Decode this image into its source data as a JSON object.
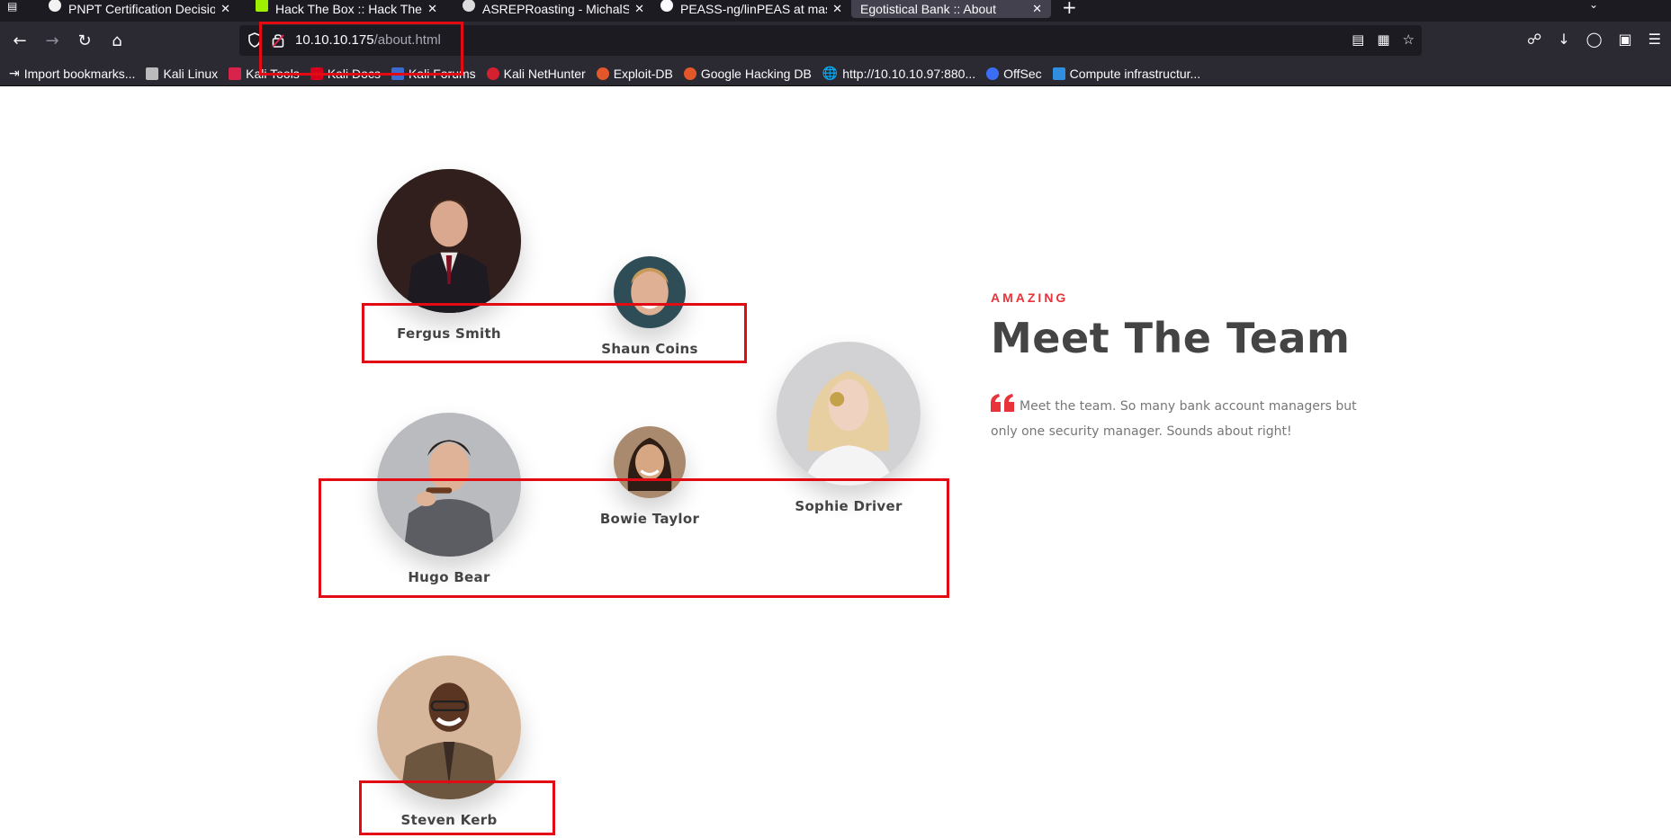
{
  "browser": {
    "tabs": [
      {
        "title": "PNPT Certification Decisio",
        "active": false
      },
      {
        "title": "Hack The Box :: Hack The",
        "active": false
      },
      {
        "title": "ASREPRoasting - MichalSz",
        "active": false
      },
      {
        "title": "PEASS-ng/linPEAS at mas",
        "active": false
      },
      {
        "title": "Egotistical Bank :: About",
        "active": true
      }
    ],
    "url_host": "10.10.10.175",
    "url_path": "/about.html",
    "bookmarks": [
      "Import bookmarks...",
      "Kali Linux",
      "Kali Tools",
      "Kali Docs",
      "Kali Forums",
      "Kali NetHunter",
      "Exploit-DB",
      "Google Hacking DB",
      "http://10.10.10.97:880...",
      "OffSec",
      "Compute infrastructur..."
    ]
  },
  "team": {
    "eyebrow": "AMAZING",
    "heading": "Meet The Team",
    "quote": "Meet the team. So many bank account managers but only one security manager. Sounds about right!",
    "members": [
      {
        "name": "Fergus Smith"
      },
      {
        "name": "Shaun Coins"
      },
      {
        "name": "Sophie Driver"
      },
      {
        "name": "Hugo Bear"
      },
      {
        "name": "Bowie Taylor"
      },
      {
        "name": "Steven Kerb"
      }
    ]
  },
  "colors": {
    "accent": "#e8333b",
    "annotation": "#e30b13",
    "heading": "#444444",
    "chrome_dark": "#1c1b22",
    "chrome": "#2b2a33"
  }
}
